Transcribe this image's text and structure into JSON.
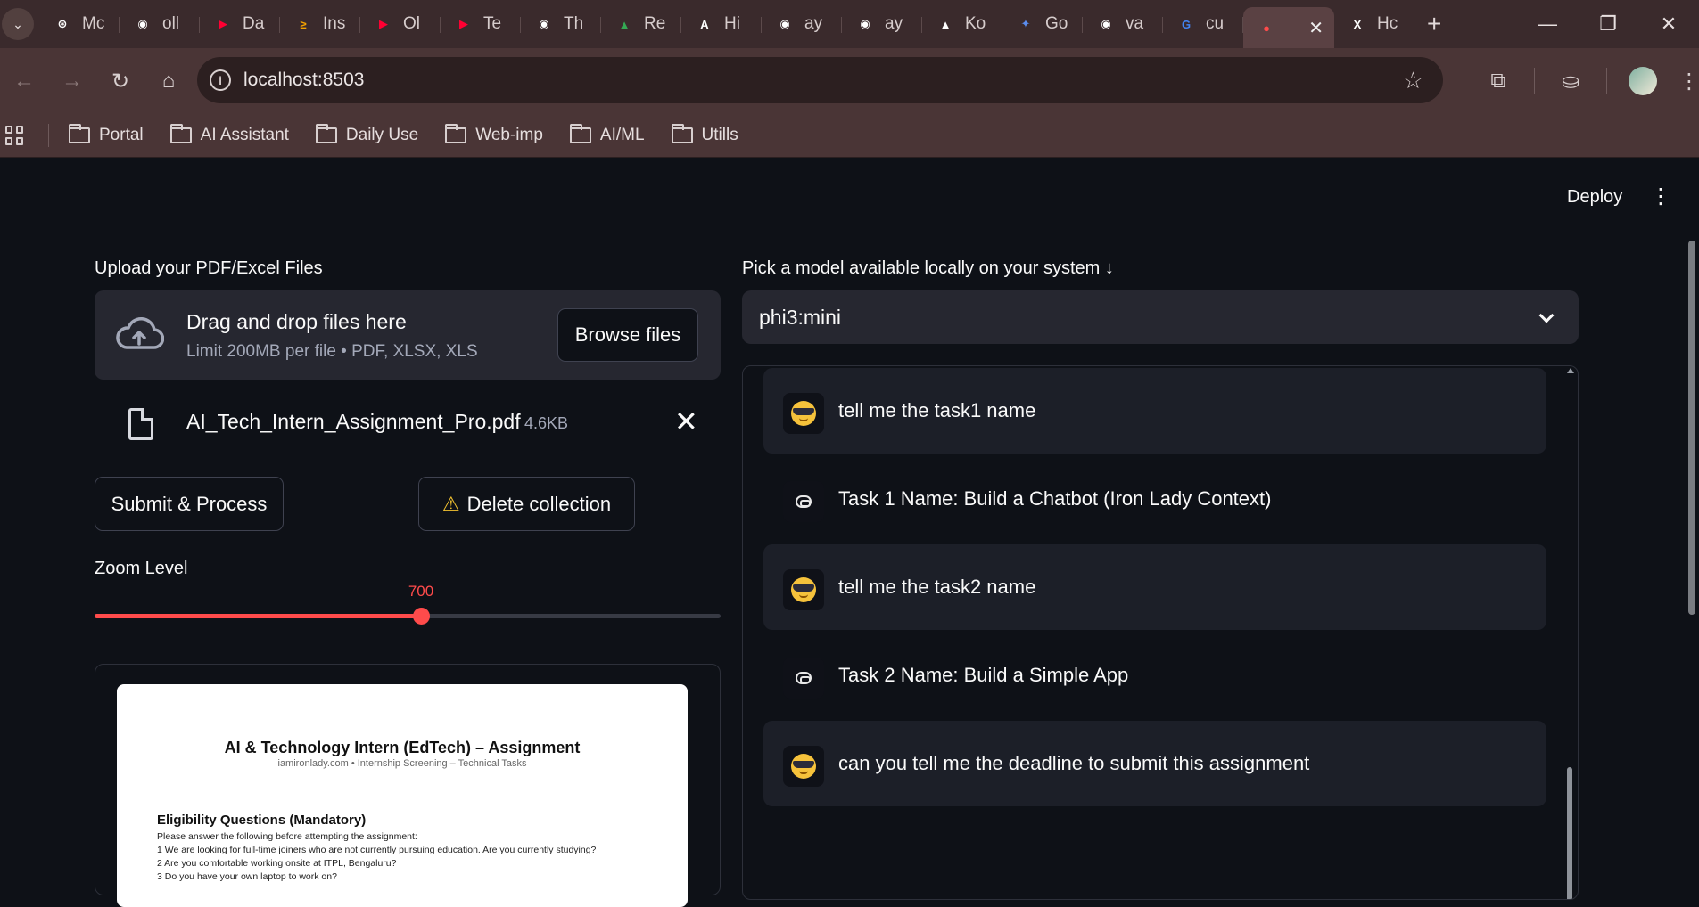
{
  "browser": {
    "tabs": [
      {
        "label": "Mc",
        "icon": "openai-icon",
        "color": "#ffffff",
        "glyph": "⊛"
      },
      {
        "label": "oll",
        "icon": "github-icon",
        "color": "#ffffff",
        "glyph": "◉"
      },
      {
        "label": "Da",
        "icon": "youtube-icon",
        "color": "#ff0033",
        "glyph": "▶"
      },
      {
        "label": "Ins",
        "icon": "brand-icon",
        "color": "#f4a300",
        "glyph": "≥"
      },
      {
        "label": "Ol",
        "icon": "youtube-icon",
        "color": "#ff0033",
        "glyph": "▶"
      },
      {
        "label": "Te",
        "icon": "youtube-icon",
        "color": "#ff0033",
        "glyph": "▶"
      },
      {
        "label": "Th",
        "icon": "github-icon",
        "color": "#ffffff",
        "glyph": "◉"
      },
      {
        "label": "Re",
        "icon": "drive-icon",
        "color": "#34a853",
        "glyph": "▲"
      },
      {
        "label": "Hi",
        "icon": "brand-icon",
        "color": "#ffffff",
        "glyph": "A"
      },
      {
        "label": "ay",
        "icon": "github-icon",
        "color": "#ffffff",
        "glyph": "◉"
      },
      {
        "label": "ay",
        "icon": "github-icon",
        "color": "#ffffff",
        "glyph": "◉"
      },
      {
        "label": "Ko",
        "icon": "brand-icon",
        "color": "#ffffff",
        "glyph": "▲"
      },
      {
        "label": "Go",
        "icon": "gemini-icon",
        "color": "#5b8def",
        "glyph": "✦"
      },
      {
        "label": "va",
        "icon": "github-icon",
        "color": "#ffffff",
        "glyph": "◉"
      },
      {
        "label": "cu",
        "icon": "google-icon",
        "color": "#4285f4",
        "glyph": "G"
      },
      {
        "label": "",
        "icon": "streamlit-icon",
        "color": "#ff4b4b",
        "glyph": "●",
        "active": true
      },
      {
        "label": "Hc",
        "icon": "x-icon",
        "color": "#ffffff",
        "glyph": "X"
      }
    ],
    "url": "localhost:8503",
    "bookmarks": [
      "Portal",
      "AI Assistant",
      "Daily Use",
      "Web-imp",
      "AI/ML",
      "Utills"
    ]
  },
  "app": {
    "deploy_label": "Deploy",
    "upload": {
      "label": "Upload your PDF/Excel Files",
      "drop_title": "Drag and drop files here",
      "drop_sub": "Limit 200MB per file • PDF, XLSX, XLS",
      "browse_label": "Browse files",
      "file_name": "AI_Tech_Intern_Assignment_Pro.pdf",
      "file_size": "4.6KB"
    },
    "buttons": {
      "submit": "Submit & Process",
      "delete": "Delete collection"
    },
    "zoom": {
      "label": "Zoom Level",
      "value": 700,
      "min": 100,
      "max": 1000
    },
    "pdf_preview": {
      "title": "AI & Technology Intern (EdTech) – Assignment",
      "subtitle": "iamironlady.com • Internship Screening – Technical Tasks",
      "heading": "Eligibility Questions (Mandatory)",
      "lines": [
        "Please answer the following before attempting the assignment:",
        "1     We are looking for full-time joiners who are not currently pursuing education. Are you currently studying?",
        "2     Are you comfortable working onsite at ITPL, Bengaluru?",
        "3     Do you have your own laptop to work on?"
      ]
    },
    "model": {
      "label": "Pick a model available locally on your system ↓",
      "selected": "phi3:mini"
    },
    "messages": [
      {
        "role": "user",
        "text": "tell me the task1 name"
      },
      {
        "role": "assistant",
        "text": "Task 1 Name: Build a Chatbot (Iron Lady Context)"
      },
      {
        "role": "user",
        "text": "tell me the task2 name"
      },
      {
        "role": "assistant",
        "text": "Task 2 Name: Build a Simple App"
      },
      {
        "role": "user",
        "text": "can you tell me the deadline to submit this assignment"
      }
    ]
  }
}
